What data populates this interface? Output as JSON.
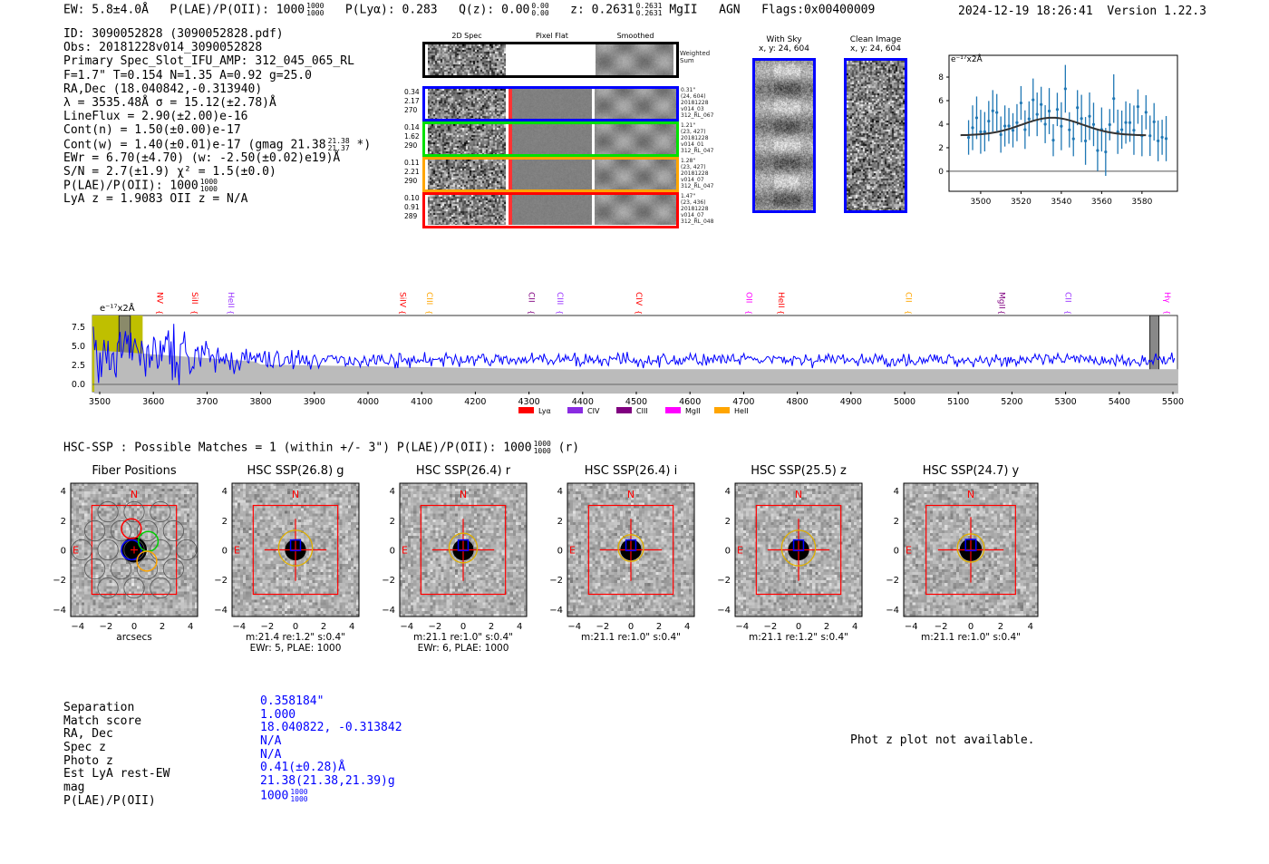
{
  "header": {
    "ew": "EW: 5.8±4.0Å",
    "plae_label": "P(LAE)/P(OII): 1000",
    "plae_hi": "1000",
    "plae_lo": "1000",
    "plya": "P(Lyα): 0.283",
    "qz": "Q(z): 0.00",
    "qz_hi": "0.00",
    "qz_lo": "0.00",
    "z": "z: 0.2631",
    "z_hi": "0.2631",
    "z_lo": "0.2631",
    "line": "MgII",
    "agn": "AGN",
    "flags": "Flags:0x00400009",
    "datetime": "2024-12-19 18:26:41",
    "version": "Version 1.22.3"
  },
  "info": {
    "id": "ID: 3090052828 (3090052828.pdf)",
    "obs": "Obs: 20181228v014_3090052828",
    "primary": "Primary Spec_Slot_IFU_AMP: 312_045_065_RL",
    "params": "F=1.7\"  T=0.154  N=1.35  A=0.92  g=25.0",
    "radec": "RA,Dec (18.040842,-0.313940)",
    "lambda": "λ = 3535.48Å   σ = 15.12(±2.78)Å",
    "lineflux": "LineFlux = 2.90(±2.00)e-16",
    "contn": "Cont(n) = 1.50(±0.00)e-17",
    "contw": "Cont(w) = 1.40(±0.01)e-17 (gmag 21.38",
    "contw_hi": "21.38",
    "contw_lo": "21.37",
    "contw_end": " *)",
    "ewr": "EWr = 6.70(±4.70) (w: -2.50(±0.02)e19)Å",
    "sn": "S/N = 2.7(±1.9)  χ² = 1.5(±0.0)",
    "plae": "P(LAE)/P(OII): 1000",
    "plae_hi": "1000",
    "plae_lo": "1000",
    "z": "LyA z = 1.9083  OII z = N/A"
  },
  "cutouts": {
    "headers": [
      "2D Spec",
      "Pixel Flat",
      "Smoothed"
    ],
    "weighted_label": "Weighted Sum",
    "rows": [
      {
        "color": "#0000ff",
        "left": [
          "0.34",
          "2.17",
          "270"
        ],
        "right": [
          "0.31\"",
          "(24, 604)",
          "20181228",
          "v014_03",
          "312_RL_067"
        ]
      },
      {
        "color": "#00e000",
        "left": [
          "0.14",
          "1.62",
          "290"
        ],
        "right": [
          "1.21\"",
          "(23, 427)",
          "20181228",
          "v014_01",
          "312_RL_047"
        ]
      },
      {
        "color": "#ffa500",
        "left": [
          "0.11",
          "2.21",
          "290"
        ],
        "right": [
          "1.28\"",
          "(23, 427)",
          "20181228",
          "v014_07",
          "312_RL_047"
        ]
      },
      {
        "color": "#ff0000",
        "left": [
          "0.10",
          "0.91",
          "289"
        ],
        "right": [
          "1.47\"",
          "(23, 436)",
          "20181228",
          "v014_07",
          "312_RL_048"
        ]
      }
    ]
  },
  "sky": {
    "with_sky_title": "With Sky",
    "with_sky_coords": "x, y: 24, 604",
    "clean_title": "Clean Image",
    "clean_coords": "x, y: 24, 604"
  },
  "fit_plot": {
    "unit": "e⁻¹⁷x2Å",
    "xticks": [
      "3500",
      "3520",
      "3540",
      "3560",
      "3580"
    ],
    "yticks": [
      "0",
      "2",
      "4",
      "6",
      "8"
    ]
  },
  "spectrum": {
    "unit": "e⁻¹⁷x2Å",
    "yticks": [
      "0.0",
      "2.5",
      "5.0",
      "7.5"
    ],
    "xticks": [
      "3500",
      "3600",
      "3700",
      "3800",
      "3900",
      "4000",
      "4100",
      "4200",
      "4300",
      "4400",
      "4500",
      "4600",
      "4700",
      "4800",
      "4900",
      "5000",
      "5100",
      "5200",
      "5300",
      "5400",
      "5500"
    ],
    "lines": [
      {
        "name": "NV",
        "wave": 3612,
        "color": "#ff0000"
      },
      {
        "name": "SiII",
        "wave": 3677,
        "color": "#ff0000"
      },
      {
        "name": "HeII",
        "wave": 3745,
        "color": "#9933ff"
      },
      {
        "name": "SiIV",
        "wave": 4065,
        "color": "#ff0000"
      },
      {
        "name": "CIII",
        "wave": 4115,
        "color": "#ffa500"
      },
      {
        "name": "CII",
        "wave": 4305,
        "color": "#800080"
      },
      {
        "name": "CIII",
        "wave": 4358,
        "color": "#9933ff"
      },
      {
        "name": "CIV",
        "wave": 4505,
        "color": "#ff0000"
      },
      {
        "name": "OII",
        "wave": 4710,
        "color": "#ff00ff"
      },
      {
        "name": "HeII",
        "wave": 4770,
        "color": "#ff0000"
      },
      {
        "name": "CII",
        "wave": 5008,
        "color": "#ffa500"
      },
      {
        "name": "MgII",
        "wave": 5182,
        "color": "#800080"
      },
      {
        "name": "CII",
        "wave": 5305,
        "color": "#9933ff"
      },
      {
        "name": "Hγ",
        "wave": 5490,
        "color": "#ff00ff"
      }
    ],
    "legend": [
      {
        "name": "Lyα",
        "color": "#ff0000"
      },
      {
        "name": "CIV",
        "color": "#8a2be2"
      },
      {
        "name": "CIII",
        "color": "#800080"
      },
      {
        "name": "MgII",
        "color": "#ff00ff"
      },
      {
        "name": "HeII",
        "color": "#ffa500"
      }
    ]
  },
  "hsc": {
    "title": "HSC-SSP : Possible Matches = 1 (within +/- 3\")  P(LAE)/P(OII): 1000",
    "title_hi": "1000",
    "title_lo": "1000",
    "title_end": " (r)",
    "axis_ticks": [
      "4",
      "2",
      "0",
      "−2",
      "−4"
    ],
    "xticks": [
      "−4",
      "−2",
      "0",
      "2",
      "4"
    ],
    "north": "N",
    "east": "E",
    "panels": [
      {
        "title": "Fiber Positions",
        "cap1": "arcsecs",
        "cap2": ""
      },
      {
        "title": "HSC SSP(26.8) g",
        "cap1": "m:21.4  re:1.2\"  s:0.4\"",
        "cap2": "EWr: 5, PLAE: 1000"
      },
      {
        "title": "HSC SSP(26.4) r",
        "cap1": "m:21.1  re:1.0\"  s:0.4\"",
        "cap2": "EWr: 6, PLAE: 1000"
      },
      {
        "title": "HSC SSP(26.4) i",
        "cap1": "m:21.1  re:1.0\"  s:0.4\"",
        "cap2": ""
      },
      {
        "title": "HSC SSP(25.5) z",
        "cap1": "m:21.1  re:1.2\"  s:0.4\"",
        "cap2": ""
      },
      {
        "title": "HSC SSP(24.7) y",
        "cap1": "m:21.1  re:1.0\"  s:0.4\"",
        "cap2": ""
      }
    ]
  },
  "match": {
    "labels": [
      "Separation",
      "Match score",
      "RA, Dec",
      "Spec z",
      "Photo z",
      "Est LyA rest-EW",
      "mag",
      "P(LAE)/P(OII)"
    ],
    "values": [
      "0.358184\"",
      "1.000",
      "18.040822, -0.313842",
      "N/A",
      "N/A",
      "0.41(±0.28)Å",
      "21.38(21.38,21.39)g",
      "1000"
    ],
    "plae_hi": "1000",
    "plae_lo": "1000"
  },
  "photz_msg": "Phot z plot not available."
}
